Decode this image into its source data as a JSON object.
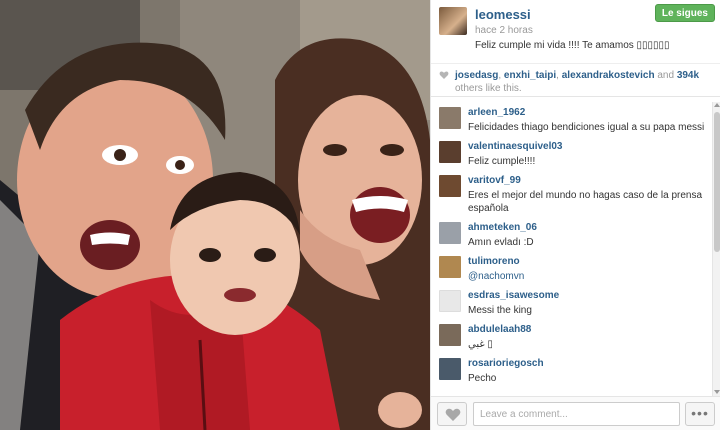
{
  "post": {
    "username": "leomessi",
    "time_ago": "hace 2 horas",
    "caption": "Feliz cumple mi vida !!!! Te amamos ▯▯▯▯▯▯",
    "follow_label": "Le sigues"
  },
  "likes": {
    "users": [
      "josedasg",
      "enxhi_taipi",
      "alexandrakostevich"
    ],
    "separator": ", ",
    "and_text": " and ",
    "count": "394k",
    "suffix": " others like this."
  },
  "comments": [
    {
      "user": "arleen_1962",
      "text": "Felicidades thiago bendiciones igual a su papa messi",
      "avatar_color": "#8a7a6a"
    },
    {
      "user": "valentinaesquivel03",
      "text": "Feliz cumple!!!!",
      "avatar_color": "#5a3e2e"
    },
    {
      "user": "varitovf_99",
      "text": "Eres el mejor del mundo no hagas caso de la prensa española",
      "avatar_color": "#6e4a30"
    },
    {
      "user": "ahmeteken_06",
      "text": "Amın evladı :D",
      "avatar_color": "#9aa0a8"
    },
    {
      "user": "tulimoreno",
      "text": "@nachomvn",
      "avatar_color": "#b08850",
      "is_link": true
    },
    {
      "user": "esdras_isawesome",
      "text": "Messi the king",
      "avatar_color": "#e8e8e8"
    },
    {
      "user": "abdulelaah88",
      "text": "غبي ▯",
      "avatar_color": "#7a6a5a"
    },
    {
      "user": "rosarioriegosch",
      "text": "Pecho",
      "avatar_color": "#4a5a6a"
    }
  ],
  "footer": {
    "comment_placeholder": "Leave a comment...",
    "more_label": "•••"
  },
  "colors": {
    "username": "#2d5f8a",
    "follow_button": "#5fb35b",
    "muted": "#999999"
  },
  "icons": {
    "like": "heart-icon",
    "more": "ellipsis-icon"
  }
}
